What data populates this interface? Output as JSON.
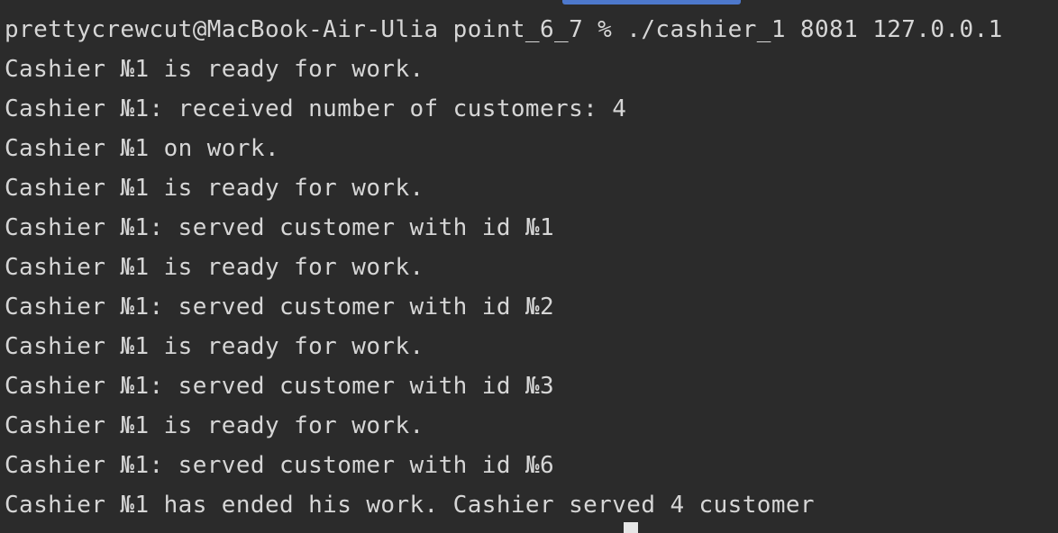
{
  "terminal": {
    "lines": [
      "prettycrewcut@MacBook-Air-Ulia point_6_7 % ./cashier_1 8081 127.0.0.1",
      "Cashier №1 is ready for work.",
      "Cashier №1: received number of customers: 4",
      "Cashier №1 on work.",
      "Cashier №1 is ready for work.",
      "Cashier №1: served customer with id №1",
      "Cashier №1 is ready for work.",
      "Cashier №1: served customer with id №2",
      "Cashier №1 is ready for work.",
      "Cashier №1: served customer with id №3",
      "Cashier №1 is ready for work.",
      "Cashier №1: served customer with id №6",
      "Cashier №1 has ended his work. Cashier served 4 customer"
    ]
  },
  "colors": {
    "background": "#2b2b2b",
    "text": "#d6d6d6",
    "scroll_indicator": "#4d78cc",
    "cursor": "#e6e6e6"
  }
}
